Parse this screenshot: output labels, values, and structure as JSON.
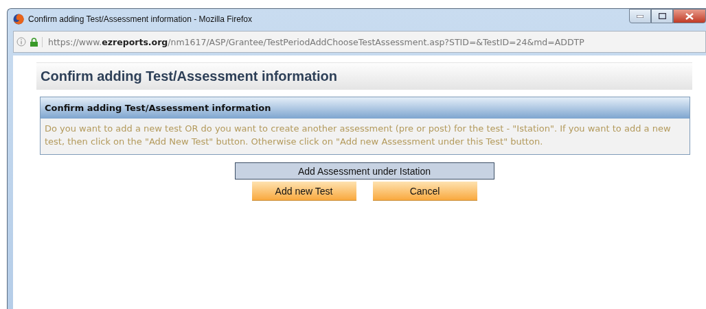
{
  "window": {
    "title": "Confirm adding Test/Assessment information - Mozilla Firefox"
  },
  "address_bar": {
    "url": "https://www.**ezreports.org**/nm1617/ASP/Grantee/TestPeriodAddChooseTestAssessment.asp?STID=&TestID=24&md=ADDTP"
  },
  "page": {
    "heading": "Confirm adding Test/Assessment information",
    "panel": {
      "title": "Confirm adding Test/Assessment information",
      "message": "Do you want to add a new test OR do you want to create another assessment (pre or post) for the test - \"Istation\". If you want to add a new test, then click on the \"Add New Test\" button. Otherwise click on \"Add new Assessment under this Test\" button."
    },
    "buttons": [
      {
        "label": "Add Assessment under Istation",
        "kind": "wide"
      },
      {
        "label": "Add new Test",
        "kind": "orange"
      },
      {
        "label": "Cancel",
        "kind": "orange"
      }
    ]
  }
}
